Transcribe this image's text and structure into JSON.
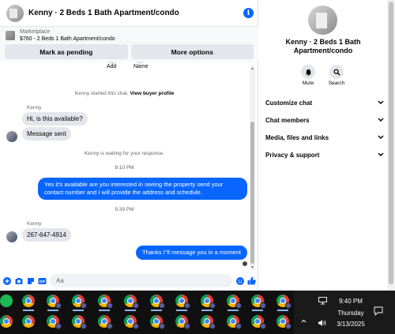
{
  "header": {
    "title": "Kenny · 2 Beds 1 Bath Apartment/condo"
  },
  "listing": {
    "source": "Marketplace",
    "name": "$760 - 2 Beds 1 Bath Apartment/condo"
  },
  "actions": {
    "mark_pending": "Mark as pending",
    "more_options": "More options"
  },
  "peek": {
    "add": "Add",
    "name": "Name"
  },
  "messages": {
    "started": "Kenny started this chat.",
    "view_profile": "View buyer profile",
    "sender1": "Kenny",
    "msg1": "Hi, is this available?",
    "msg2": "Message sent",
    "waiting": "Kenny is waiting for your response.",
    "time1": "9:10 PM",
    "out1": "Yes it's available are you interested in seeing the property send your contact number and I will provide the address and schedule.",
    "time2": "9:39 PM",
    "sender2": "Kenny",
    "msg3": "267-647-4914",
    "out2": "Thanks I''ll message you in a moment"
  },
  "composer": {
    "placeholder": "Aa"
  },
  "info": {
    "name": "Kenny · 2 Beds 1 Bath Apartment/condo",
    "mute": "Mute",
    "search": "Search",
    "rows": [
      "Customize chat",
      "Chat members",
      "Media, files and links",
      "Privacy & support"
    ]
  },
  "taskbar": {
    "time": "9:40 PM",
    "day": "Thursday",
    "date": "3/13/2025"
  },
  "colors": {
    "accent": "#0866ff",
    "bubble_in": "#e4e6eb"
  }
}
